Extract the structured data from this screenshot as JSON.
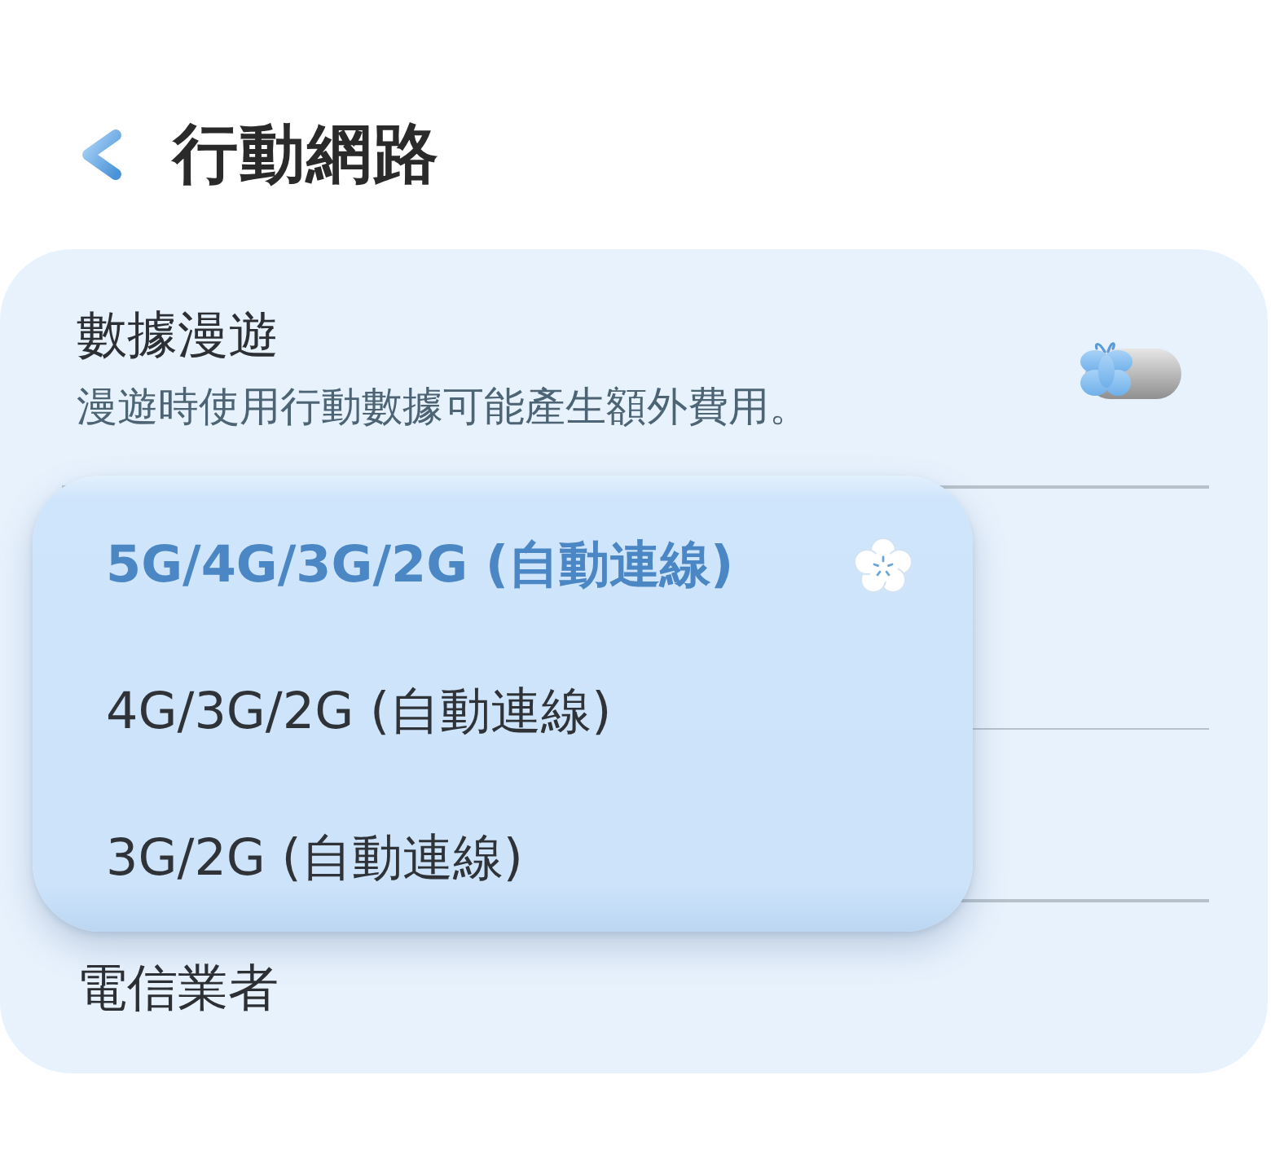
{
  "header": {
    "title": "行動網路"
  },
  "settings": [
    {
      "kind": "switch",
      "title": "數據漫遊",
      "subtitle": "漫遊時使用行動數據可能產生額外費用。",
      "on": false
    },
    {
      "kind": "plain",
      "title": "電信業者"
    }
  ],
  "network_mode_menu": {
    "options": [
      {
        "label": "5G/4G/3G/2G (自動連線)",
        "selected": true
      },
      {
        "label": "4G/3G/2G (自動連線)",
        "selected": false
      },
      {
        "label": "3G/2G (自動連線)",
        "selected": false
      }
    ]
  }
}
